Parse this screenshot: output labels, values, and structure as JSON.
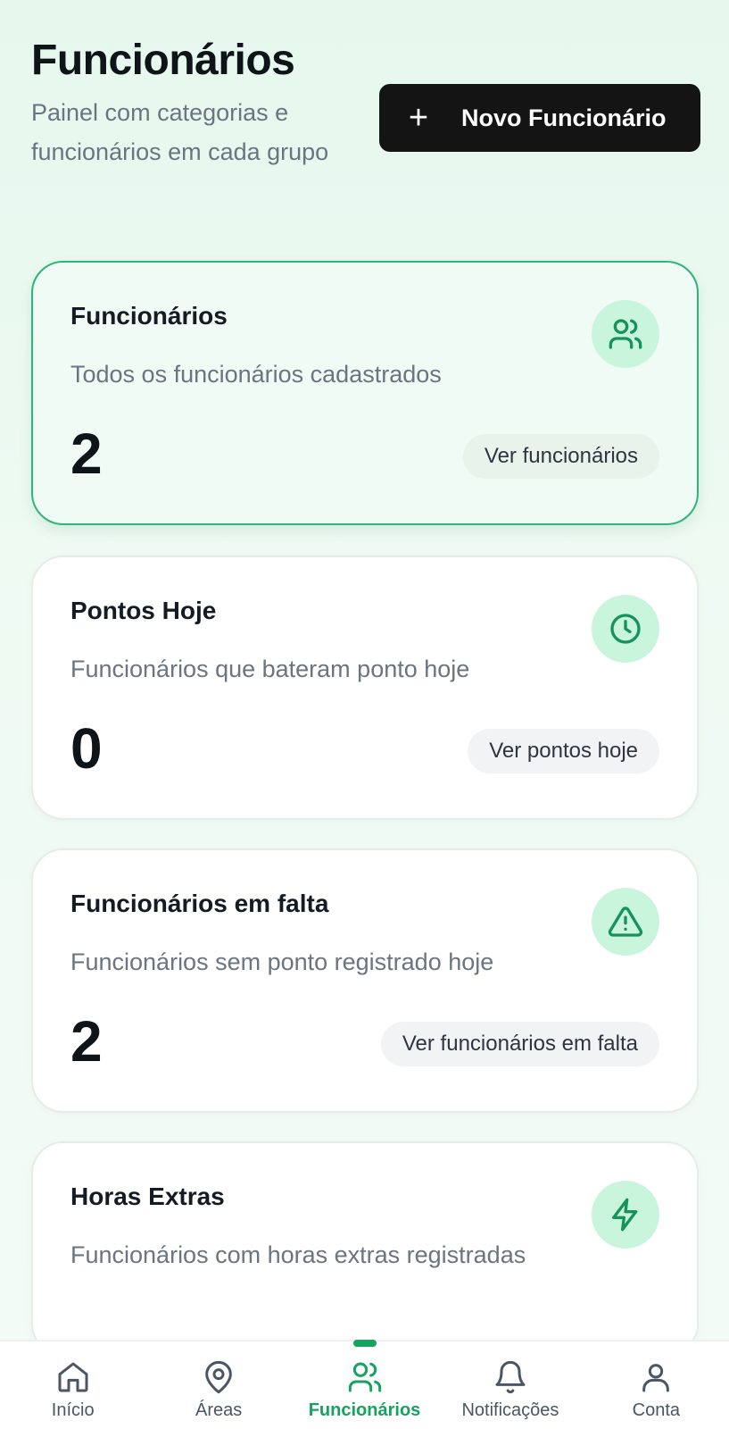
{
  "header": {
    "title": "Funcionários",
    "subtitle": "Painel com categorias e funcionários em cada grupo",
    "new_button_label": "Novo Funcionário",
    "new_button_icon": "plus-icon"
  },
  "cards": [
    {
      "title": "Funcionários",
      "description": "Todos os funcionários cadastrados",
      "count": "2",
      "link": "Ver funcionários",
      "icon": "users-icon",
      "active": true
    },
    {
      "title": "Pontos Hoje",
      "description": "Funcionários que bateram ponto hoje",
      "count": "0",
      "link": "Ver pontos hoje",
      "icon": "clock-icon",
      "active": false
    },
    {
      "title": "Funcionários em falta",
      "description": "Funcionários sem ponto registrado hoje",
      "count": "2",
      "link": "Ver funcionários em falta",
      "icon": "alert-triangle-icon",
      "active": false
    },
    {
      "title": "Horas Extras",
      "description": "Funcionários com horas extras registradas",
      "icon": "zap-icon",
      "active": false
    }
  ],
  "nav": {
    "items": [
      {
        "label": "Início",
        "icon": "home-icon"
      },
      {
        "label": "Áreas",
        "icon": "map-pin-icon"
      },
      {
        "label": "Funcionários",
        "icon": "users-icon",
        "active": true
      },
      {
        "label": "Notificações",
        "icon": "bell-icon"
      },
      {
        "label": "Conta",
        "icon": "user-icon"
      }
    ]
  },
  "colors": {
    "accent": "#16a35f",
    "icon_bg": "#c9f5dd",
    "active_border": "#2fb57a",
    "button_bg": "#141414"
  }
}
